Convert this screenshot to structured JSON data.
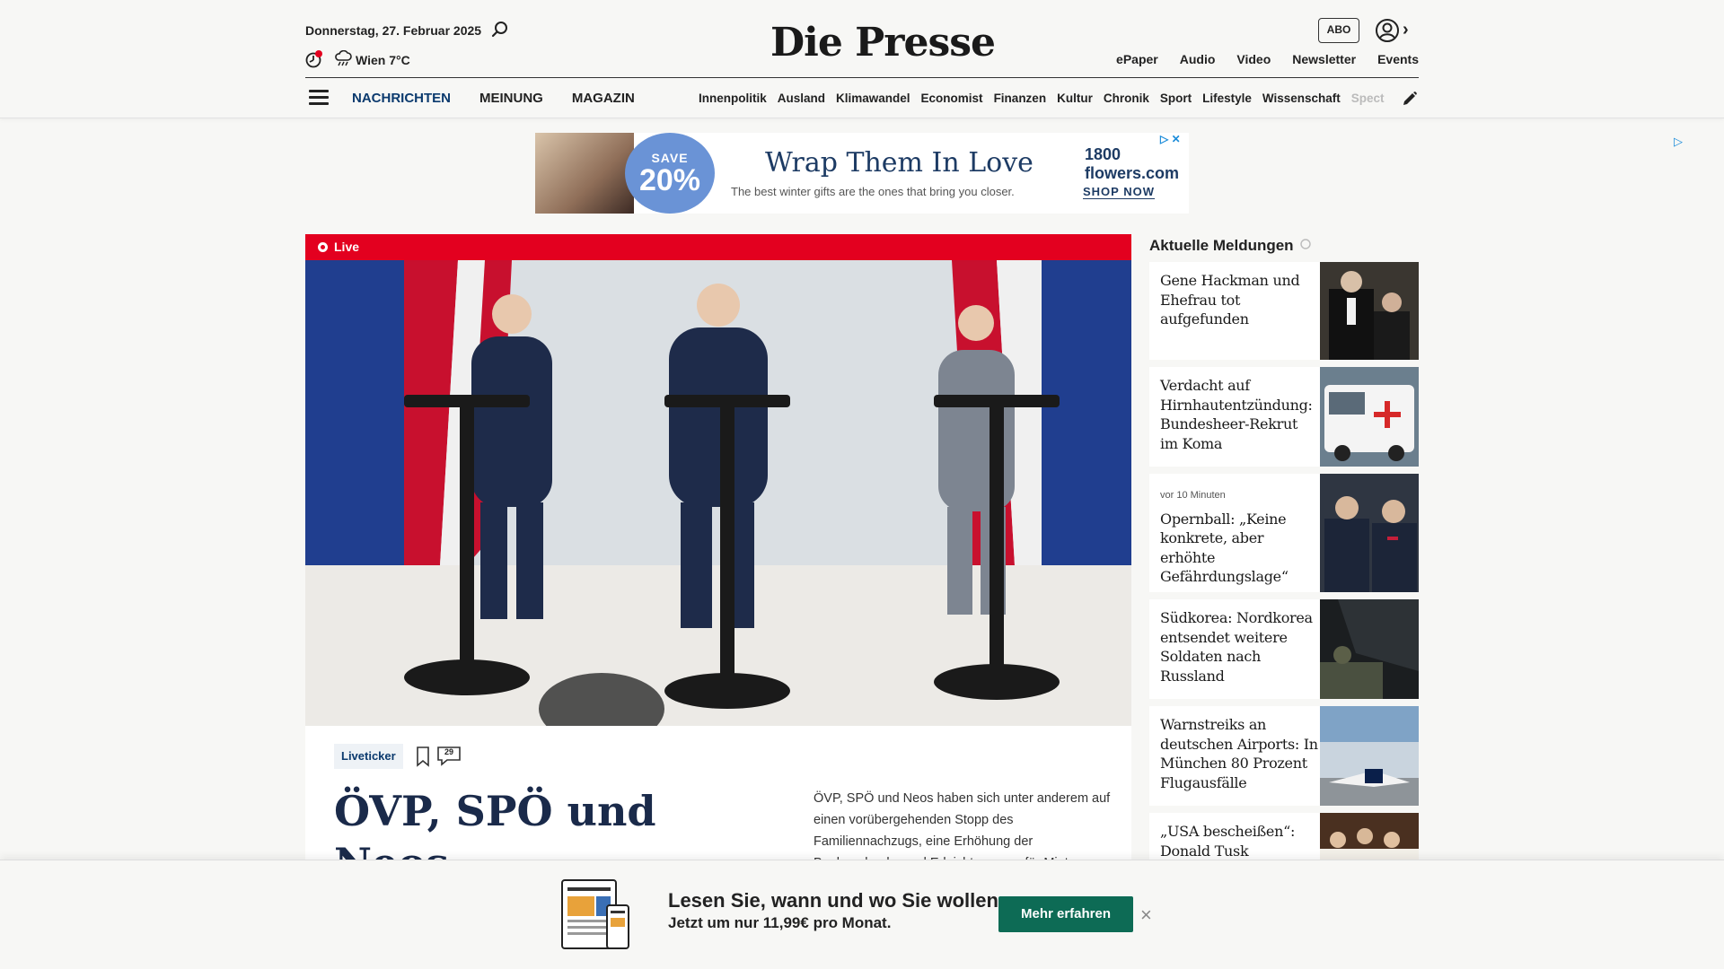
{
  "header": {
    "date": "Donnerstag, 27. Februar 2025",
    "weather": "Wien 7°C",
    "logo": "Die Presse",
    "abo": "ABO",
    "top_links": [
      "ePaper",
      "Audio",
      "Video",
      "Newsletter",
      "Events"
    ],
    "main_nav": [
      "NACHRICHTEN",
      "MEINUNG",
      "MAGAZIN"
    ],
    "sections": [
      "Innenpolitik",
      "Ausland",
      "Klimawandel",
      "Economist",
      "Finanzen",
      "Kultur",
      "Chronik",
      "Sport",
      "Lifestyle",
      "Wissenschaft",
      "Spectrum"
    ]
  },
  "ad": {
    "save_label": "SAVE",
    "save_value": "20%",
    "title": "Wrap Them In Love",
    "subtitle": "The best winter gifts are the ones that bring you closer.",
    "brand": "1800 flowers.com",
    "cta": "SHOP NOW"
  },
  "lead": {
    "live_label": "Live",
    "tag": "Liveticker",
    "comment_count": "29",
    "headline": "ÖVP, SPÖ und Neos präsentieren",
    "teaser": "ÖVP, SPÖ und Neos haben sich unter anderem auf einen vorübergehenden Stopp des Familiennachzugs, eine Erhöhung der Bankenabgabe und Erleichterungen für Mieter"
  },
  "sidebar": {
    "title": "Aktuelle Meldungen",
    "items": [
      {
        "meta": "",
        "title": "Gene Hackman und Ehefrau tot aufgefunden"
      },
      {
        "meta": "",
        "title": "Verdacht auf Hirnhautentzündung: Bundesheer-Rekrut im Koma"
      },
      {
        "meta": "vor 10 Minuten",
        "title": "Opernball: „Keine konkrete, aber erhöhte Gefährdungslage“"
      },
      {
        "meta": "",
        "title": "Südkorea: Nordkorea entsendet weitere Soldaten nach Russland"
      },
      {
        "meta": "",
        "title": "Warnstreiks an deutschen Airports: In München 80 Prozent Flugausfälle"
      },
      {
        "meta": "",
        "title": "„USA bescheißen“: Donald Tusk"
      }
    ]
  },
  "banner": {
    "headline": "Lesen Sie, wann und wo Sie wollen.",
    "sub": "Jetzt um nur 11,99€ pro Monat.",
    "cta": "Mehr erfahren",
    "close": "×"
  }
}
